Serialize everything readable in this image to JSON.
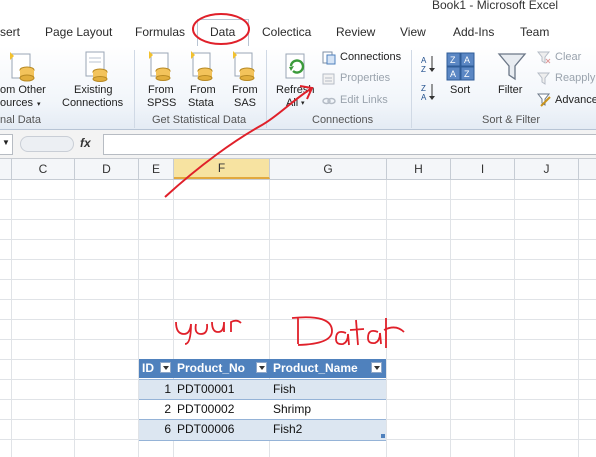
{
  "window": {
    "title": "Book1 - Microsoft Excel"
  },
  "tabs": [
    "sert",
    "Page Layout",
    "Formulas",
    "Data",
    "Colectica",
    "Review",
    "View",
    "Add-Ins",
    "Team"
  ],
  "ribbon": {
    "get_external": {
      "from_other_l1": "om Other",
      "from_other_l2": "ources",
      "existing_l1": "Existing",
      "existing_l2": "Connections",
      "group_label": "nal Data"
    },
    "statistical": {
      "spss_l1": "From",
      "spss_l2": "SPSS",
      "stata_l1": "From",
      "stata_l2": "Stata",
      "sas_l1": "From",
      "sas_l2": "SAS",
      "group_label": "Get Statistical Data"
    },
    "connections": {
      "refresh_l1": "Refresh",
      "refresh_l2": "All",
      "connections": "Connections",
      "properties": "Properties",
      "edit_links": "Edit Links",
      "group_label": "Connections"
    },
    "sort_filter": {
      "sort": "Sort",
      "filter": "Filter",
      "clear": "Clear",
      "reapply": "Reapply",
      "advanced": "Advance",
      "group_label": "Sort & Filter"
    }
  },
  "formula_bar": {
    "fx": "fx",
    "value": ""
  },
  "columns": [
    "C",
    "D",
    "E",
    "F",
    "G",
    "H",
    "I",
    "J"
  ],
  "table": {
    "headers": [
      "ID",
      "Product_No",
      "Product_Name"
    ],
    "rows": [
      {
        "id": "1",
        "product_no": "PDT00001",
        "product_name": "Fish"
      },
      {
        "id": "2",
        "product_no": "PDT00002",
        "product_name": "Shrimp"
      },
      {
        "id": "6",
        "product_no": "PDT00006",
        "product_name": "Fish2"
      }
    ]
  },
  "annotation": {
    "handwritten_text": "your Data",
    "ink_color": "#e0202a"
  },
  "colors": {
    "table_header": "#4f81bd",
    "band": "#dce6f1",
    "ribbon_bg": "#eef3f9"
  }
}
